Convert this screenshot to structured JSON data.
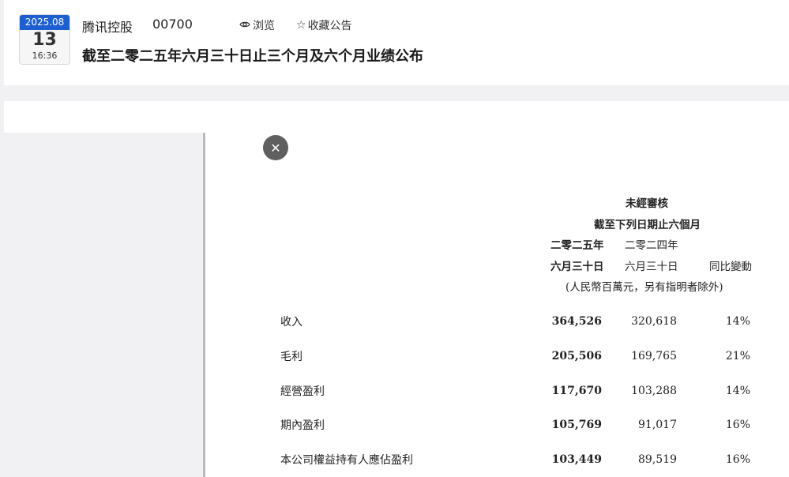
{
  "header": {
    "date_badge": {
      "year_month": "2025.08",
      "day": "13",
      "time": "16:36"
    },
    "company": "腾讯控股",
    "code": "00700",
    "browse_label": "浏览",
    "favorite_label": "收藏公告",
    "title": "截至二零二五年六月三十日止三个月及六个月业绩公布"
  },
  "document": {
    "headers": {
      "unaudited": "未經審核",
      "period": "截至下列日期止六個月",
      "col1_year": "二零二五年",
      "col2_year": "二零二四年",
      "col1_date": "六月三十日",
      "col2_date": "六月三十日",
      "col3": "同比變動",
      "units": "(人民幣百萬元，另有指明者除外)"
    },
    "rows": [
      {
        "label": "收入",
        "v2025": "364,526",
        "v2024": "320,618",
        "yoy": "14%"
      },
      {
        "label": "毛利",
        "v2025": "205,506",
        "v2024": "169,765",
        "yoy": "21%"
      },
      {
        "label": "經營盈利",
        "v2025": "117,670",
        "v2024": "103,288",
        "yoy": "14%"
      },
      {
        "label": "期內盈利",
        "v2025": "105,769",
        "v2024": "91,017",
        "yoy": "16%"
      },
      {
        "label": "本公司權益持有人應佔盈利",
        "v2025": "103,449",
        "v2024": "89,519",
        "yoy": "16%"
      }
    ]
  },
  "icons": {
    "browse": "eye-icon",
    "favorite": "star-outline-icon",
    "close": "close-icon"
  },
  "colors": {
    "badge_blue": "#1d5fd1",
    "close_button": "#5f5f5f"
  }
}
